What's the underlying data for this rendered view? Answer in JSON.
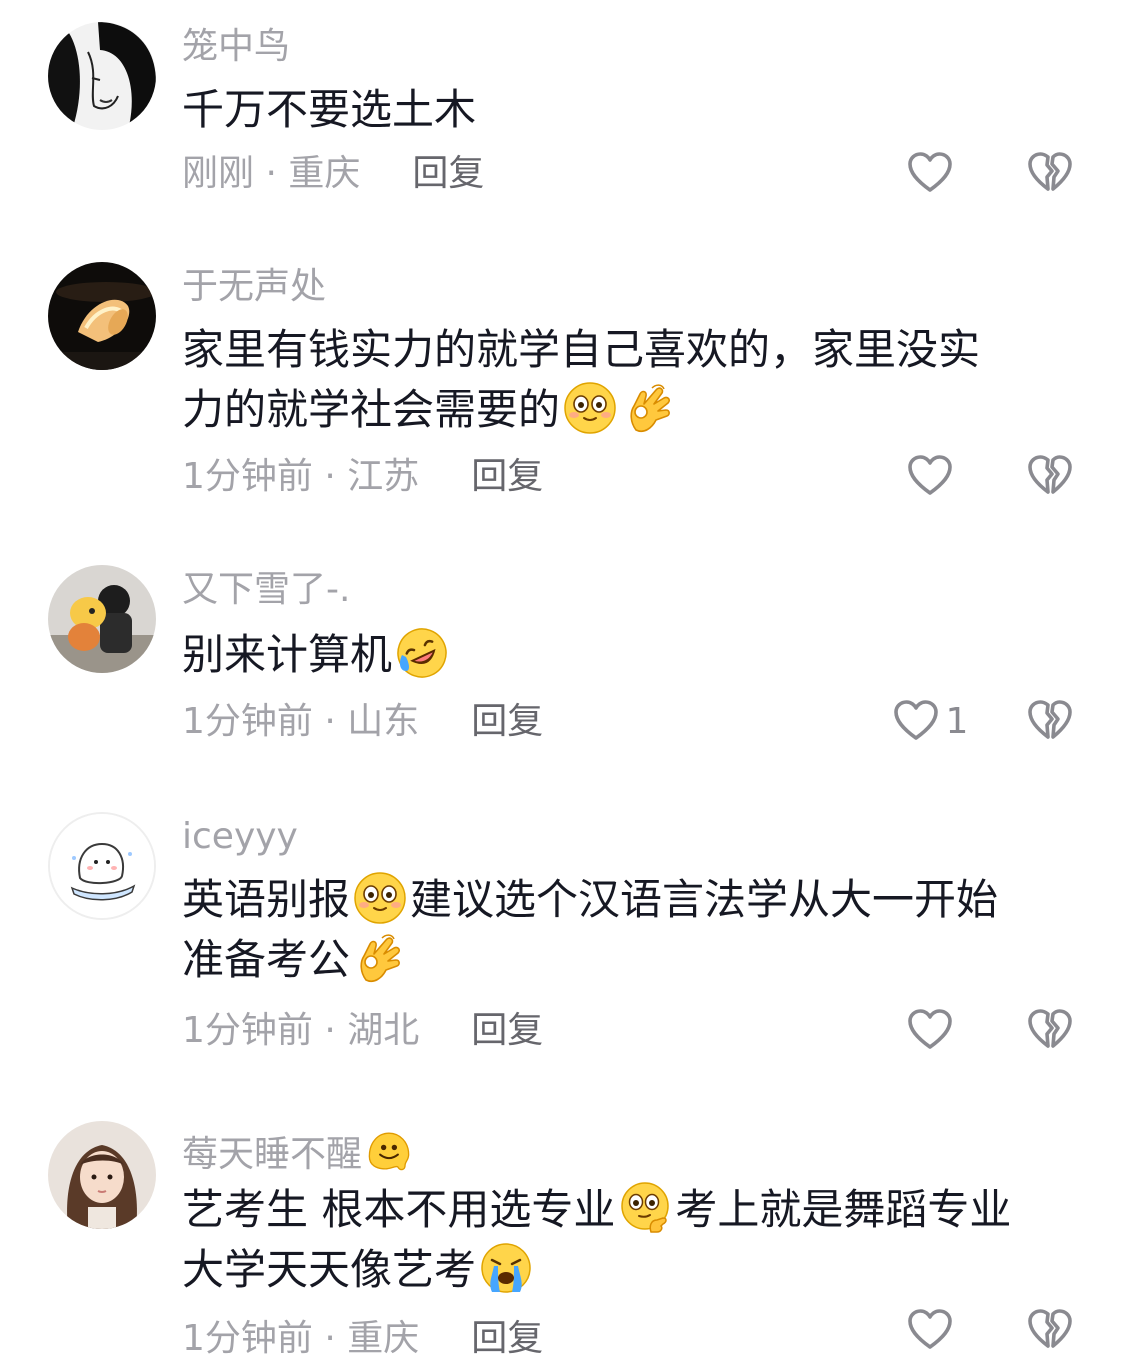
{
  "comments": [
    {
      "username": "笼中鸟",
      "content": "千万不要选土木",
      "time_location": "刚刚 · 重庆",
      "reply_label": "回复",
      "likes": ""
    },
    {
      "username": "于无声处",
      "content_line1": "家里有钱实力的就学自己喜欢的，家里没实",
      "content_line2": "力的就学社会需要的",
      "time_location": "1分钟前 · 江苏",
      "reply_label": "回复",
      "likes": ""
    },
    {
      "username": "又下雪了-.",
      "content": "别来计算机",
      "time_location": "1分钟前 · 山东",
      "reply_label": "回复",
      "likes": "1"
    },
    {
      "username": "iceyyy",
      "content_line1_a": "英语别报",
      "content_line1_b": "建议选个汉语言法学从大一开始",
      "content_line2": "准备考公",
      "time_location": "1分钟前 · 湖北",
      "reply_label": "回复",
      "likes": ""
    },
    {
      "username": "莓天睡不醒",
      "content_line1_a": "艺考生 根本不用选专业",
      "content_line1_b": "考上就是舞蹈专业",
      "content_line2": "大学天天像艺考",
      "time_location": "1分钟前 · 重庆",
      "reply_label": "回复",
      "likes": ""
    }
  ],
  "emoji_names": [
    "blush-eyes-emoji",
    "ok-hand-emoji",
    "rofl-emoji",
    "melting-face-emoji",
    "thinking-eyes-emoji",
    "crying-emoji"
  ],
  "colors": {
    "username": "#a3a3a9",
    "content": "#161823",
    "meta": "#a3a3a9",
    "reply": "#66666c",
    "icon": "#8a8a90"
  }
}
